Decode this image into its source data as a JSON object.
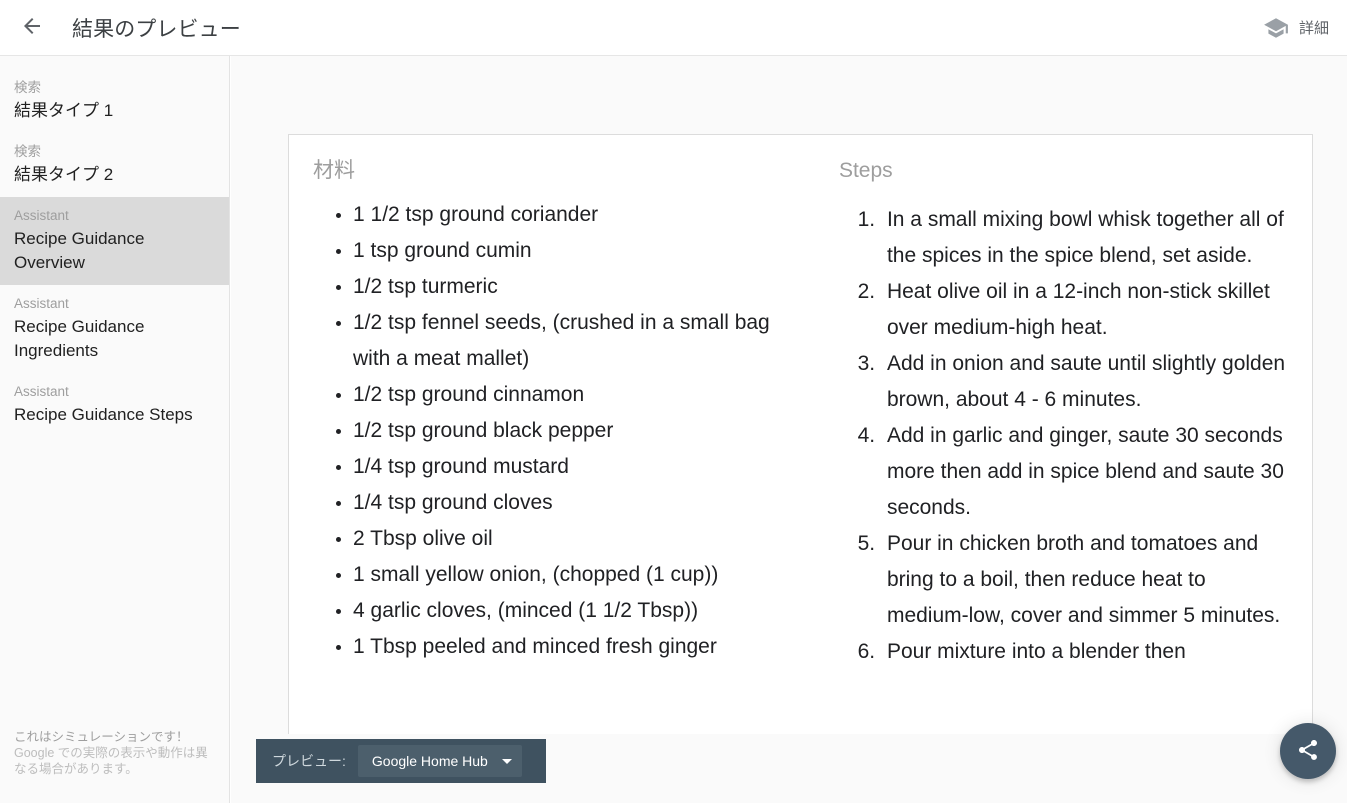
{
  "header": {
    "title": "結果のプレビュー",
    "back_icon": "arrow-back-icon",
    "details_label": "詳細",
    "details_icon": "graduation-cap-icon"
  },
  "sidebar": {
    "items": [
      {
        "kicker": "検索",
        "title": "結果タイプ 1",
        "selected": false
      },
      {
        "kicker": "検索",
        "title": "結果タイプ 2",
        "selected": false
      },
      {
        "kicker": "Assistant",
        "title": "Recipe Guidance Overview",
        "selected": true
      },
      {
        "kicker": "Assistant",
        "title": "Recipe Guidance Ingredients",
        "selected": false
      },
      {
        "kicker": "Assistant",
        "title": "Recipe Guidance Steps",
        "selected": false
      }
    ],
    "footer": {
      "line1": "これはシミュレーションです！",
      "line2": "Google での実際の表示や動作は異なる場合があります。"
    }
  },
  "content": {
    "ingredients_heading": "材料",
    "ingredients": [
      "1 1/2 tsp ground coriander",
      "1 tsp ground cumin",
      "1/2 tsp turmeric",
      "1/2 tsp fennel seeds, (crushed in a small bag with a meat mallet)",
      "1/2 tsp ground cinnamon",
      "1/2 tsp ground black pepper",
      "1/4 tsp ground mustard",
      "1/4 tsp ground cloves",
      "2 Tbsp olive oil",
      "1 small yellow onion, (chopped (1 cup))",
      "4 garlic cloves, (minced (1 1/2 Tbsp))",
      "1 Tbsp peeled and minced fresh ginger"
    ],
    "steps_heading": "Steps",
    "steps": [
      "In a small mixing bowl whisk together all of the spices in the spice blend, set aside.",
      "Heat olive oil in a 12-inch non-stick skillet over medium-high heat.",
      "Add in onion and saute until slightly golden brown, about 4 - 6 minutes.",
      "Add in garlic and ginger, saute 30 seconds more then add in spice blend and saute 30 seconds.",
      "Pour in chicken broth and tomatoes and bring to a boil, then reduce heat to medium-low, cover and simmer 5 minutes.",
      "Pour mixture into a blender then"
    ]
  },
  "preview_bar": {
    "label": "プレビュー:",
    "device": "Google Home Hub",
    "caret_icon": "chevron-down-icon"
  },
  "fab": {
    "icon": "share-icon"
  },
  "colors": {
    "accent_dark": "#3f5260",
    "fab": "#45596a",
    "selected_sidebar": "#dadada",
    "stage_bg": "#fafafa",
    "muted_text": "#9e9e9e"
  }
}
